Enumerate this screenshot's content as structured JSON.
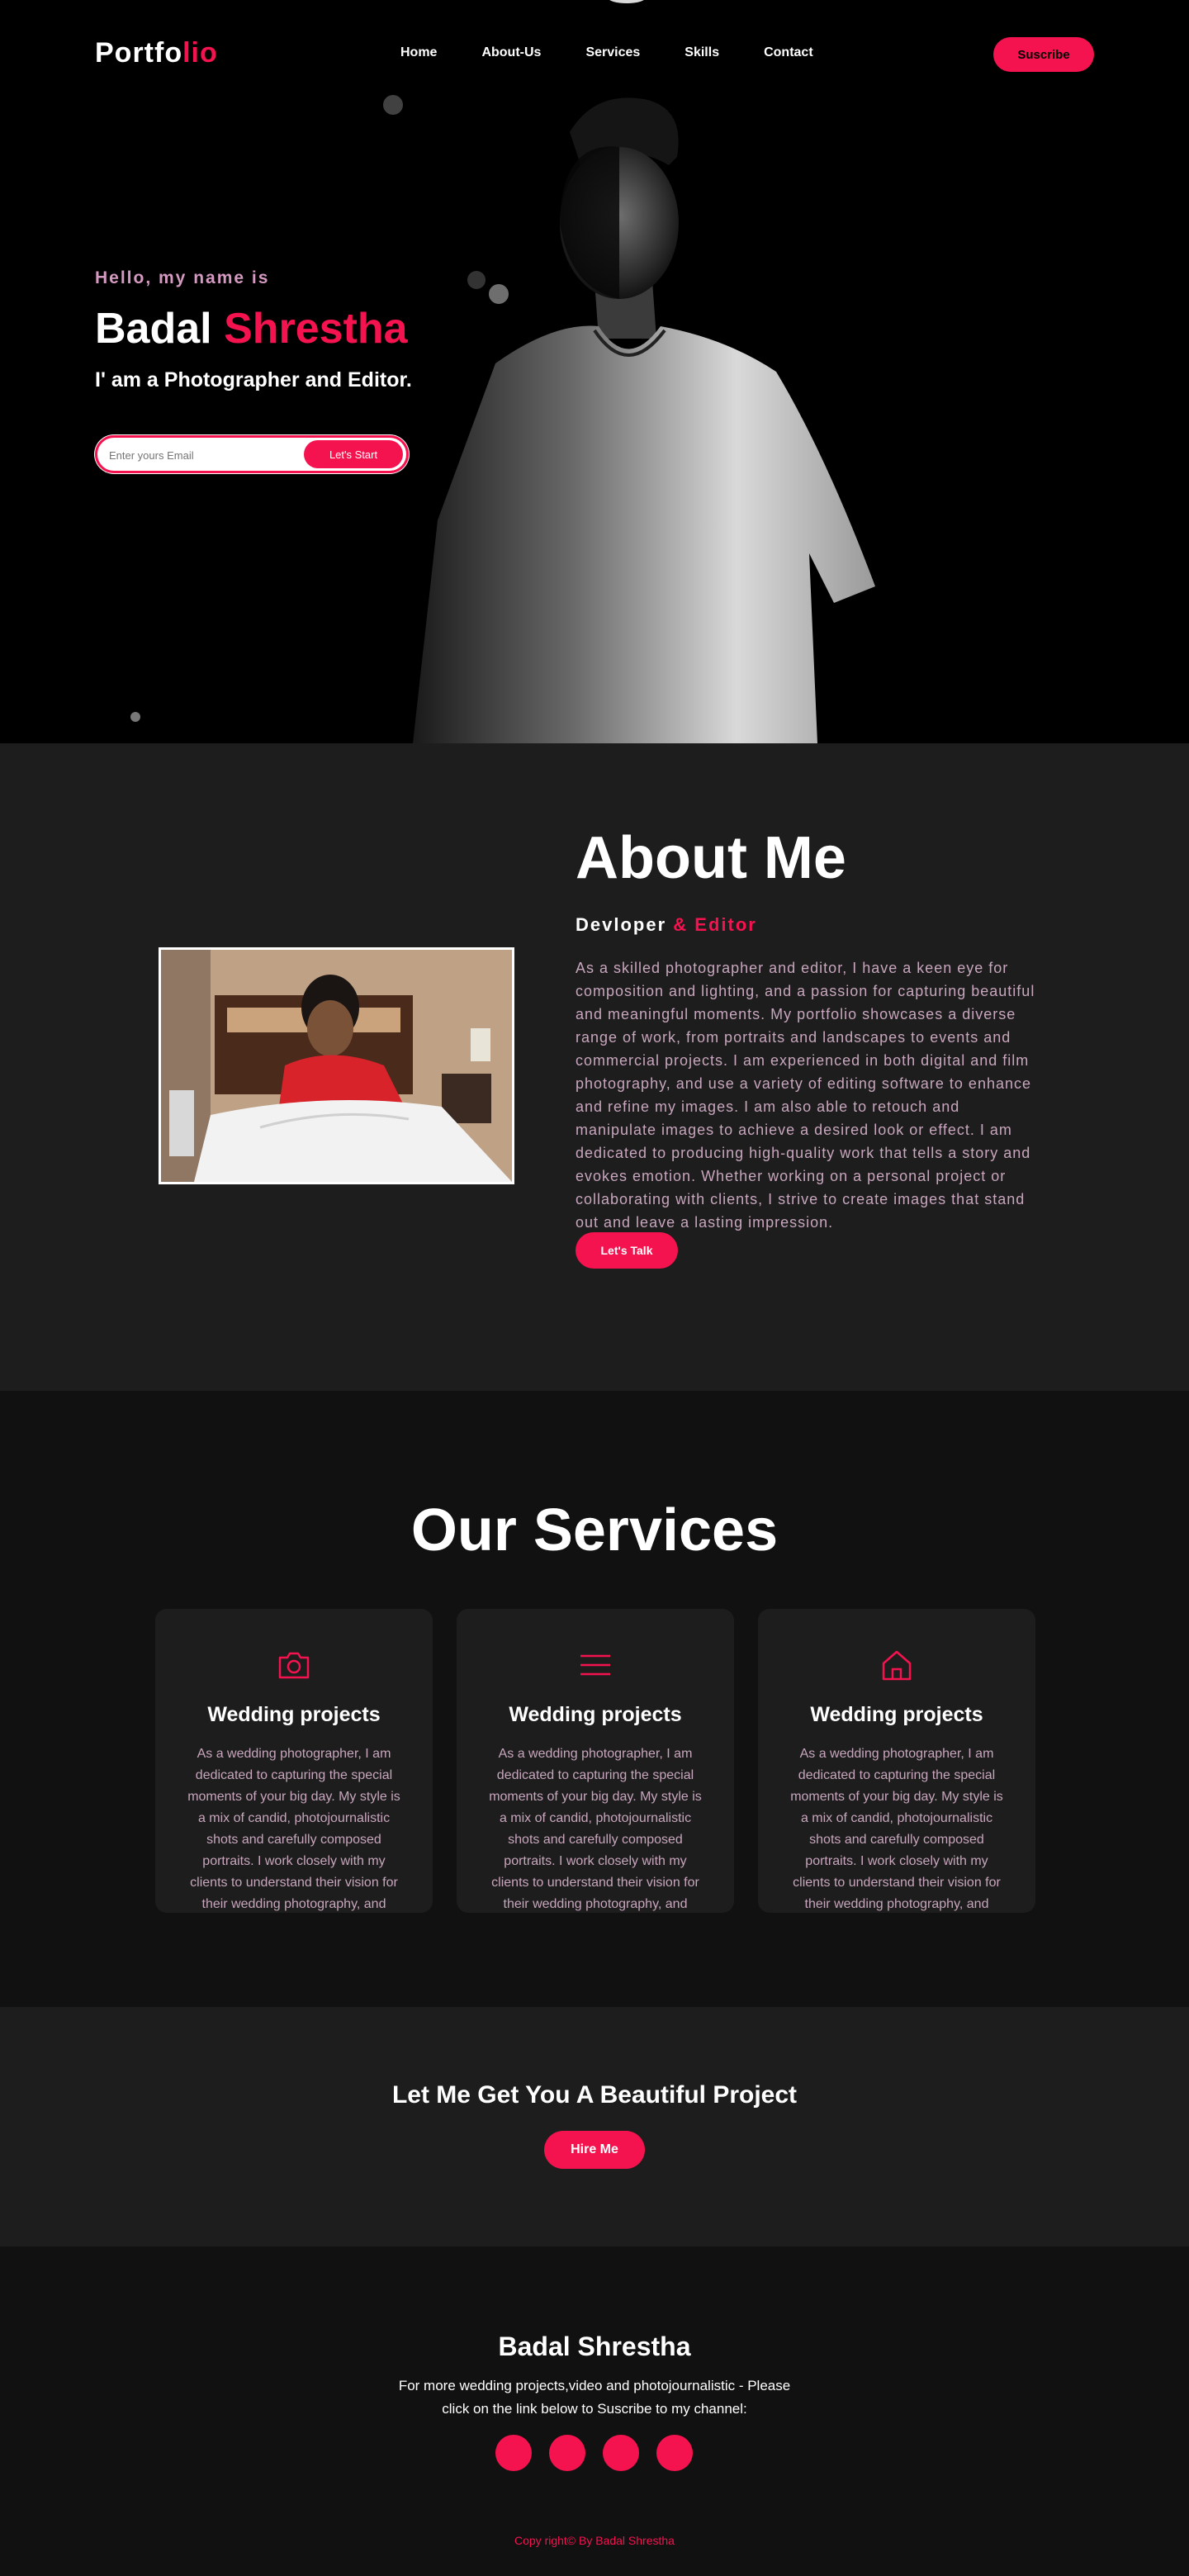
{
  "nav": {
    "logo_part1": "Portfo",
    "logo_part2": "lio",
    "menu": [
      "Home",
      "About-Us",
      "Services",
      "Skills",
      "Contact"
    ],
    "subscribe_label": "Suscribe"
  },
  "hero": {
    "greeting": "Hello, my name is",
    "first_name": "Badal",
    "last_name": "Shrestha",
    "tagline": "I' am a Photographer and Editor.",
    "email_placeholder": "Enter yours Email",
    "start_label": "Let's Start"
  },
  "about": {
    "title": "About Me",
    "subtitle_part1": "Devloper",
    "subtitle_part2": " & Editor",
    "text": "As a skilled photographer and editor, I have a keen eye for composition and lighting, and a passion for capturing beautiful and meaningful moments. My portfolio showcases a diverse range of work, from portraits and landscapes to events and commercial projects. I am experienced in both digital and film photography, and use a variety of editing software to enhance and refine my images. I am also able to retouch and manipulate images to achieve a desired look or effect. I am dedicated to producing high-quality work that tells a story and evokes emotion. Whether working on a personal project or collaborating with clients, I strive to create images that stand out and leave a lasting impression.",
    "talk_label": "Let's Talk"
  },
  "services": {
    "title": "Our Services",
    "cards": [
      {
        "icon": "camera-icon",
        "title": "Wedding projects",
        "text": "As a wedding photographer, I am dedicated to capturing the special moments of your big day. My style is a mix of candid, photojournalistic shots and carefully composed portraits. I work closely with my clients to understand their vision for their wedding photography, and"
      },
      {
        "icon": "menu-icon",
        "title": "Wedding projects",
        "text": "As a wedding photographer, I am dedicated to capturing the special moments of your big day. My style is a mix of candid, photojournalistic shots and carefully composed portraits. I work closely with my clients to understand their vision for their wedding photography, and"
      },
      {
        "icon": "home-icon",
        "title": "Wedding projects",
        "text": "As a wedding photographer, I am dedicated to capturing the special moments of your big day. My style is a mix of candid, photojournalistic shots and carefully composed portraits. I work closely with my clients to understand their vision for their wedding photography, and"
      }
    ]
  },
  "cta": {
    "title": "Let Me Get You A Beautiful Project",
    "hire_label": "Hire Me"
  },
  "footer": {
    "name": "Badal Shrestha",
    "text": "For more wedding projects,video and photojournalistic - Please click on the link below to Suscribe to my channel:",
    "copyright": "Copy right© By Badal Shrestha",
    "social_icons": [
      "social-icon-1",
      "social-icon-2",
      "social-icon-3",
      "social-icon-4"
    ]
  },
  "colors": {
    "accent": "#f5134f",
    "background": "#000000",
    "section_dark": "#1d1d1d",
    "section_darker": "#111111",
    "muted_text": "#c8a6bd"
  }
}
